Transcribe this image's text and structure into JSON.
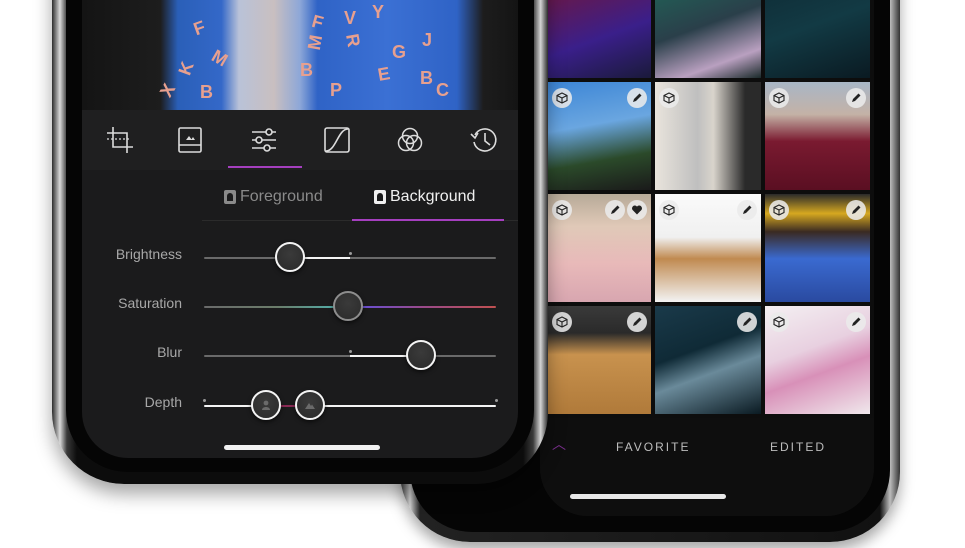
{
  "editor": {
    "toolbar": [
      {
        "icon": "crop-icon",
        "label": "Crop",
        "active": false
      },
      {
        "icon": "image-frame-icon",
        "label": "Frame",
        "active": false
      },
      {
        "icon": "sliders-icon",
        "label": "Adjust",
        "active": true
      },
      {
        "icon": "curves-icon",
        "label": "Curves",
        "active": false
      },
      {
        "icon": "color-circles-icon",
        "label": "Color",
        "active": false
      },
      {
        "icon": "history-icon",
        "label": "History",
        "active": false
      }
    ],
    "segments": {
      "foreground": "Foreground",
      "background": "Background",
      "selected": "Background"
    },
    "sliders": [
      {
        "label": "Brightness",
        "value": -0.4,
        "range": [
          -1,
          1
        ]
      },
      {
        "label": "Saturation",
        "value": 0.0,
        "range": [
          -1,
          1
        ]
      },
      {
        "label": "Blur",
        "value": 0.5,
        "range": [
          -1,
          1
        ]
      },
      {
        "label": "Depth",
        "foreground_value": 0.22,
        "background_value": 0.37,
        "range": [
          0,
          1
        ]
      }
    ],
    "accent_color": "#a53fbf"
  },
  "gallery": {
    "tiles": [
      {
        "subject": "neon red portrait",
        "cube": false,
        "edit": false
      },
      {
        "subject": "neon green dancer",
        "cube": false,
        "edit": false
      },
      {
        "subject": "neon teal portrait",
        "cube": false,
        "edit": false
      },
      {
        "subject": "woman under palm trees",
        "cube": true,
        "edit": true
      },
      {
        "subject": "blonde in white coat",
        "cube": true,
        "edit": false
      },
      {
        "subject": "woman in red blazer",
        "cube": true,
        "edit": true
      },
      {
        "subject": "girl in pink coat",
        "cube": true,
        "edit": true,
        "favorite": true
      },
      {
        "subject": "woman holding dog",
        "cube": true,
        "edit": true
      },
      {
        "subject": "man in yellow beanie",
        "cube": true,
        "edit": true
      },
      {
        "subject": "man in tan coat",
        "cube": true,
        "edit": true
      },
      {
        "subject": "city aerial",
        "cube": false,
        "edit": true
      },
      {
        "subject": "pink blossoms",
        "cube": true,
        "edit": true
      }
    ],
    "bottom_tabs": {
      "chevron": "^",
      "favorite": "FAVORITE",
      "edited": "EDITED"
    }
  }
}
